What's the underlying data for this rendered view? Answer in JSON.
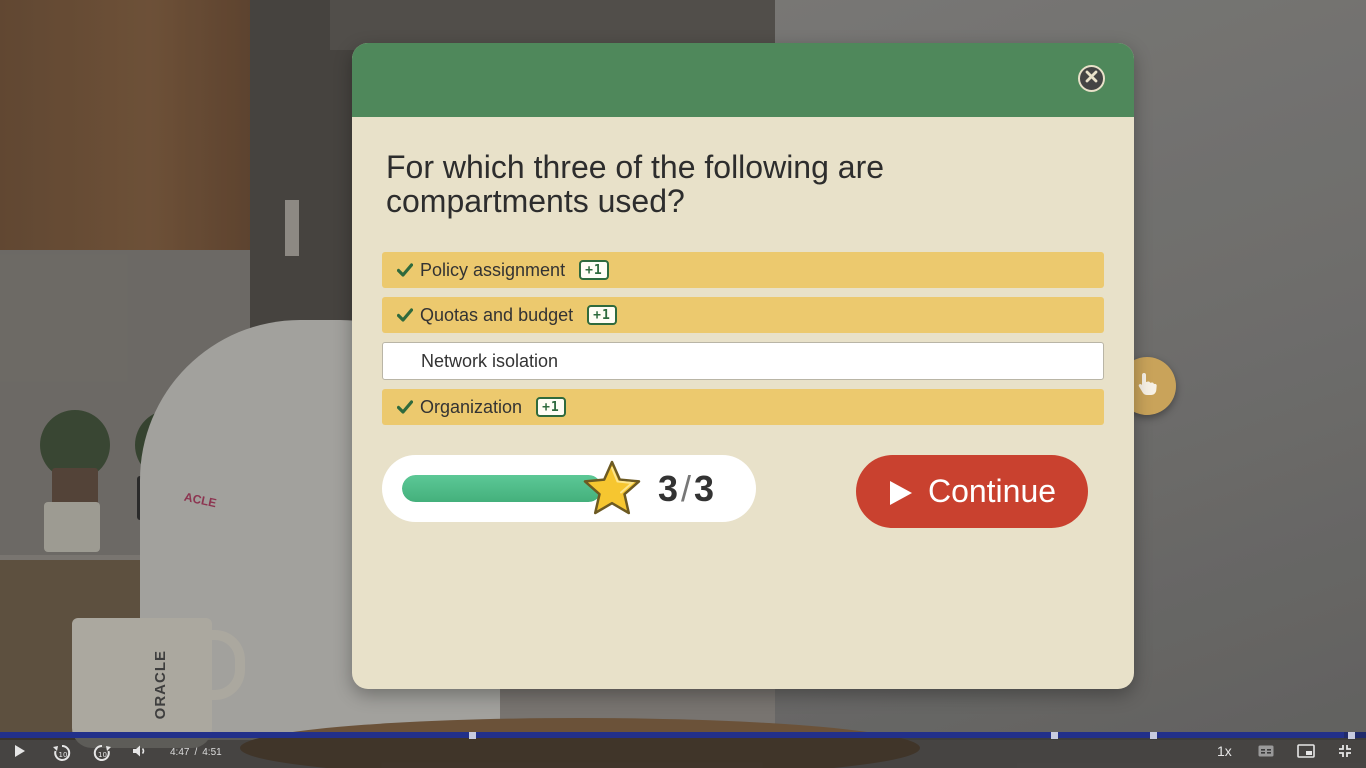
{
  "video": {
    "person_logo": "ACLE",
    "mug_text": "ORACLE",
    "time_current": "4:47",
    "time_separator": "/",
    "time_total": "4:51",
    "progress_fraction": 0.984,
    "speed_label": "1x",
    "controls": {
      "play": "play-icon",
      "rewind": "rewind-10-icon",
      "forward": "forward-10-icon",
      "volume": "volume-icon",
      "captions": "captions-icon",
      "pip": "picture-in-picture-icon",
      "fullscreen": "exit-fullscreen-icon"
    }
  },
  "quiz": {
    "question": "For which three of the following are compartments used?",
    "options": [
      {
        "label": "Policy assignment",
        "selected": true,
        "points": "+1"
      },
      {
        "label": "Quotas and budget",
        "selected": true,
        "points": "+1"
      },
      {
        "label": "Network isolation",
        "selected": false,
        "points": ""
      },
      {
        "label": "Organization",
        "selected": true,
        "points": "+1"
      }
    ],
    "score": {
      "current": "3",
      "separator": "/",
      "total": "3",
      "fraction": 1.0
    },
    "continue_label": "Continue",
    "colors": {
      "header": "#4f885b",
      "body": "#e8e1c9",
      "correct": "#ecc96e",
      "continue": "#c9412f"
    }
  }
}
